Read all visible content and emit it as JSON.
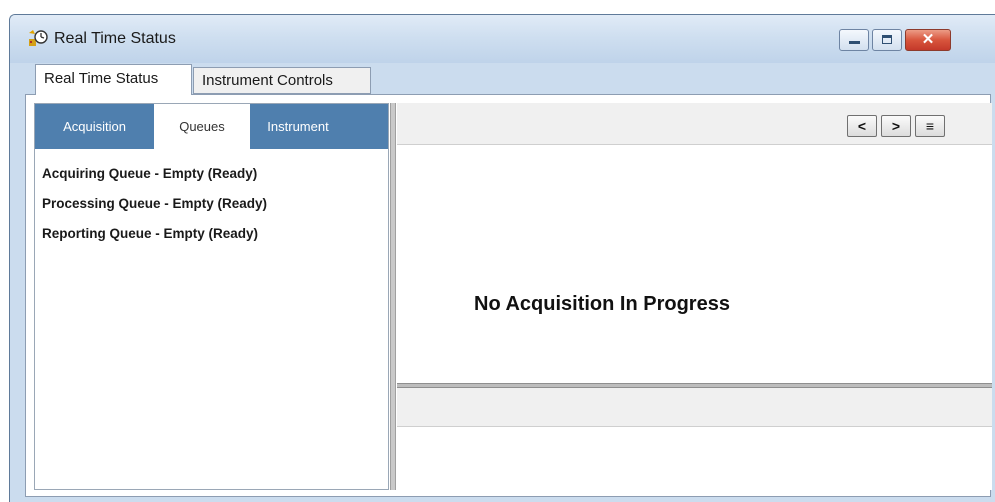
{
  "window": {
    "title": "Real Time Status",
    "controls": {
      "close_glyph": "✕"
    }
  },
  "tabs": [
    {
      "label": "Real Time Status",
      "active": true
    },
    {
      "label": "Instrument Controls",
      "active": false
    }
  ],
  "subtabs": [
    {
      "label": "Acquisition",
      "active": false
    },
    {
      "label": "Queues",
      "active": true
    },
    {
      "label": "Instrument",
      "active": false
    }
  ],
  "queues": [
    "Acquiring Queue - Empty (Ready)",
    "Processing Queue - Empty (Ready)",
    "Reporting Queue - Empty (Ready)"
  ],
  "toolbar": {
    "prev_glyph": "<",
    "next_glyph": ">",
    "menu_glyph": "≡"
  },
  "status_message": "No Acquisition In Progress",
  "colors": {
    "subtab_bar": "#4f7fae",
    "window_frame": "#cbdcee",
    "close_button": "#c4392a"
  },
  "icons": [
    "app-icon",
    "minimize-icon",
    "maximize-icon",
    "close-icon",
    "chevron-left-icon",
    "chevron-right-icon",
    "menu-icon"
  ]
}
